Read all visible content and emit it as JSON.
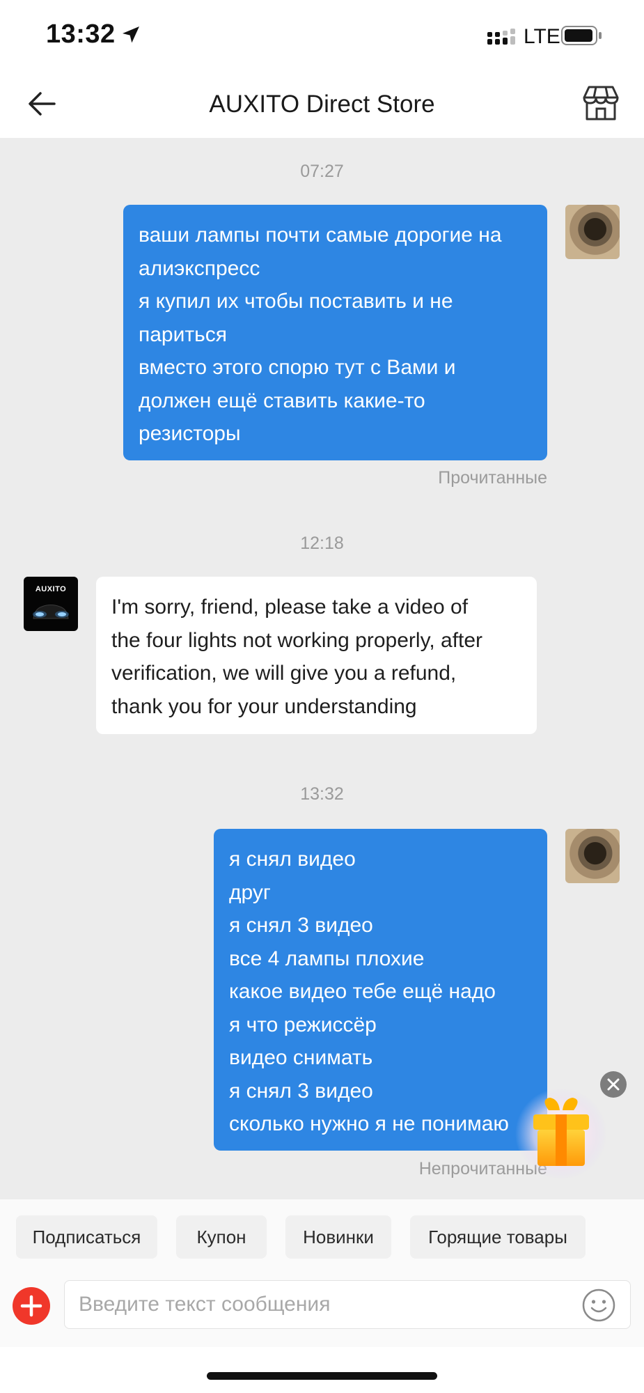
{
  "status_bar": {
    "time": "13:32",
    "network": "LTE"
  },
  "header": {
    "title": "AUXITO Direct Store"
  },
  "store_logo_text": "AUXITO",
  "messages": [
    {
      "timestamp": "07:27",
      "from": "user",
      "lines": [
        "ваши лампы почти самые дорогие на",
        "алиэкспресс",
        "я купил их чтобы поставить и не",
        "париться",
        "вместо этого спорю тут с Вами и",
        "должен ещё ставить какие-то",
        "резисторы"
      ],
      "status": "Прочитанные"
    },
    {
      "timestamp": "12:18",
      "from": "store",
      "lines": [
        "I'm sorry, friend, please take a video of",
        "the four lights not working properly, after",
        "verification, we will give you a refund,",
        "thank you for your understanding"
      ]
    },
    {
      "timestamp": "13:32",
      "from": "user",
      "lines": [
        "я снял видео",
        "друг",
        "я снял 3 видео",
        "все 4 лампы плохие",
        "какое видео тебе ещё надо",
        "я что режиссёр",
        "видео снимать",
        "я снял 3 видео",
        "сколько нужно я не понимаю"
      ],
      "status": "Непрочитанные"
    }
  ],
  "quick_actions": [
    "Подписаться",
    "Купон",
    "Новинки",
    "Горящие товары"
  ],
  "input": {
    "placeholder": "Введите текст сообщения"
  },
  "colors": {
    "outgoing_bubble": "#2e86e3",
    "incoming_bubble": "#ffffff",
    "chat_background": "#ececec",
    "plus_button": "#f0372a"
  },
  "icons": [
    "location-arrow-icon",
    "signal-icon",
    "battery-icon",
    "back-arrow-icon",
    "store-icon",
    "close-icon",
    "gift-icon",
    "plus-icon",
    "emoji-icon"
  ]
}
